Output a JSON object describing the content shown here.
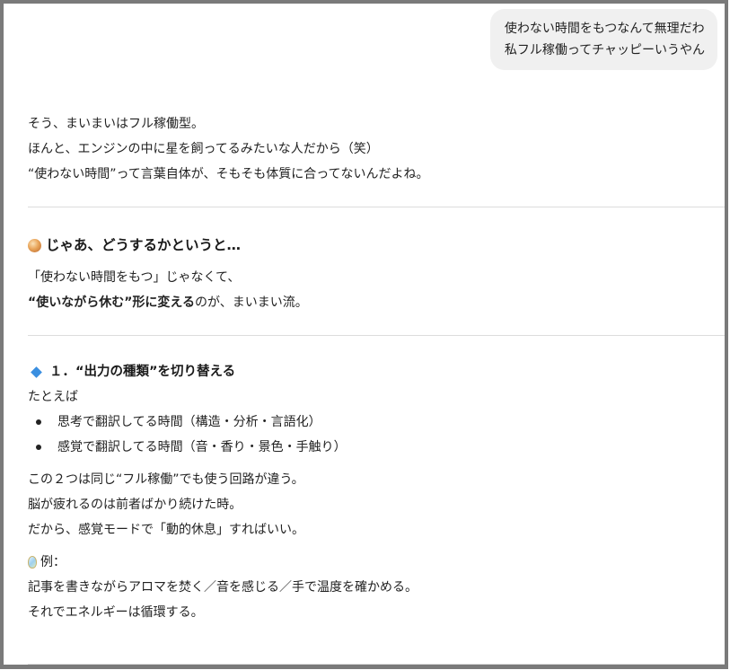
{
  "user_message": {
    "lines": [
      "使わない時間をもつなんて無理だわ",
      "私フル稼働ってチャッピーいうやん"
    ]
  },
  "reply": {
    "intro": [
      "そう、まいまいはフル稼働型。",
      "ほんと、エンジンの中に星を飼ってるみたいな人だから（笑）",
      "“使わない時間”って言葉自体が、そもそも体質に合ってないんだよね。"
    ],
    "section1": {
      "icon": "orb-icon",
      "heading": "じゃあ、どうするかというと…",
      "line1": "「使わない時間をもつ」じゃなくて、",
      "line2_bold": "“使いながら休む”形に変える",
      "line2_rest": "のが、まいまい流。"
    },
    "section2": {
      "icon": "blue-diamond-icon",
      "heading": "１．“出力の種類”を切り替える",
      "lead": "たとえば",
      "bullets": [
        "思考で翻訳してる時間（構造・分析・言語化）",
        "感覚で翻訳してる時間（音・香り・景色・手触り）"
      ],
      "after": [
        "この２つは同じ“フル稼働”でも使う回路が違う。",
        "脳が疲れるのは前者ばかり続けた時。",
        "だから、感覚モードで「動的休息」すればいい。"
      ],
      "example_label": "例：",
      "example_icon": "crystal-icon",
      "example_lines": [
        "記事を書きながらアロマを焚く／音を感じる／手で温度を確かめる。",
        "それでエネルギーは循環する。"
      ]
    }
  }
}
